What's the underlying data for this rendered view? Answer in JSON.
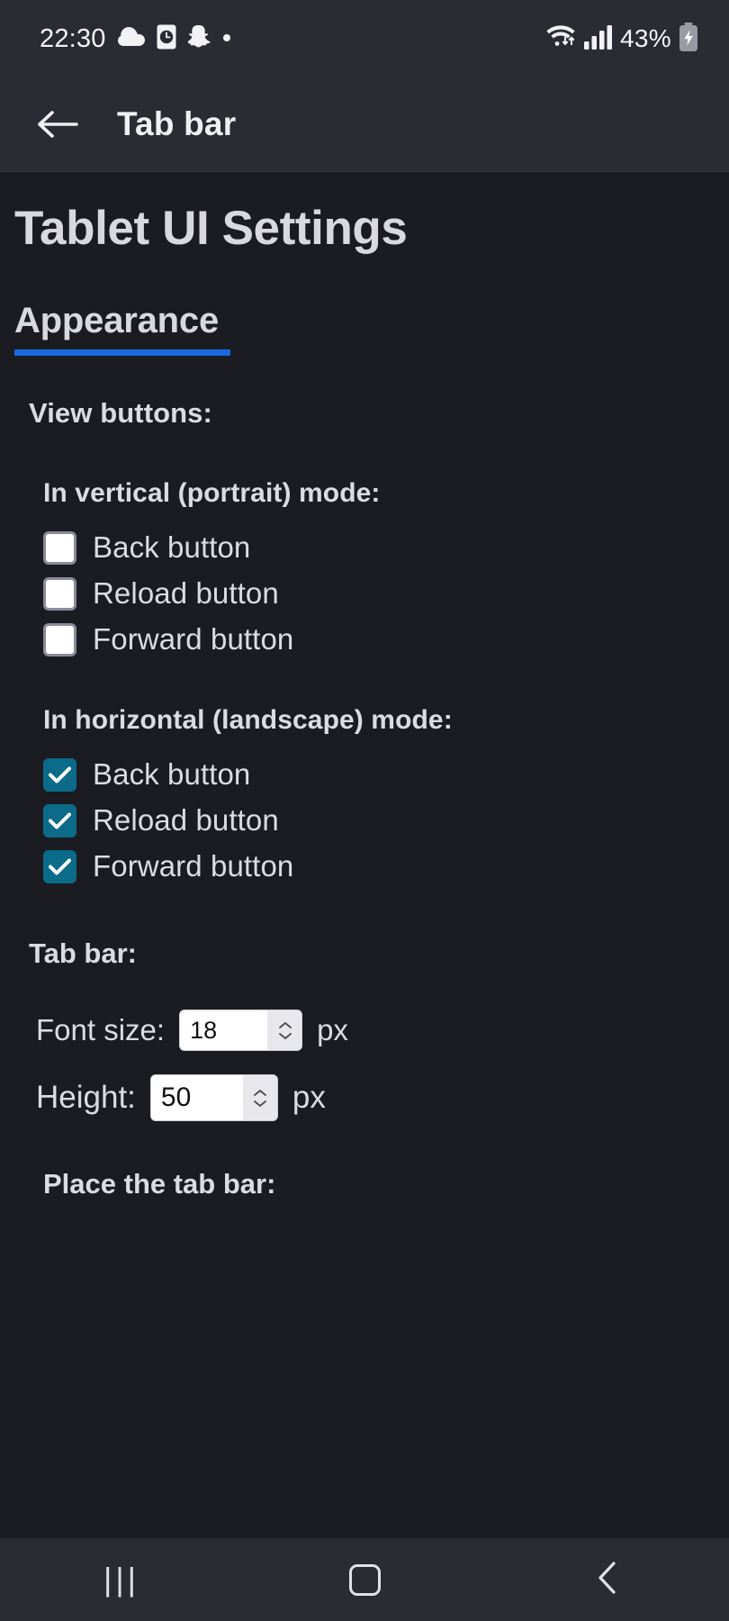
{
  "status_bar": {
    "time": "22:30",
    "left_icons": [
      "cloud-icon",
      "alarm-clock-icon",
      "snapchat-ghost-icon",
      "dot-icon"
    ],
    "right_icons": [
      "wifi-icon",
      "cellular-signal-icon"
    ],
    "battery_percent": "43%",
    "battery_icon": "battery-charging-icon"
  },
  "app_bar": {
    "back_icon": "back-arrow-icon",
    "title": "Tab bar"
  },
  "page": {
    "title": "Tablet UI Settings",
    "section": {
      "label": "Appearance",
      "underline_color": "#1a69e0"
    },
    "view_buttons": {
      "label": "View buttons:",
      "portrait": {
        "label": "In vertical (portrait) mode:",
        "options": [
          {
            "label": "Back button",
            "checked": false
          },
          {
            "label": "Reload button",
            "checked": false
          },
          {
            "label": "Forward button",
            "checked": false
          }
        ]
      },
      "landscape": {
        "label": "In horizontal (landscape) mode:",
        "options": [
          {
            "label": "Back button",
            "checked": true
          },
          {
            "label": "Reload button",
            "checked": true
          },
          {
            "label": "Forward button",
            "checked": true
          }
        ]
      }
    },
    "tab_bar": {
      "label": "Tab bar:",
      "font_size": {
        "label": "Font size:",
        "value": "18",
        "unit": "px",
        "spinner_icon": "spinner-up-down-icon"
      },
      "height": {
        "label": "Height:",
        "value": "50",
        "unit": "px",
        "spinner_icon": "spinner-up-down-icon"
      },
      "place_label": "Place the tab bar:"
    }
  },
  "nav_bar": {
    "recents": "|||",
    "recents_icon": "recents-icon",
    "home_icon": "home-square-icon",
    "back_icon": "nav-back-chevron-icon"
  },
  "colors": {
    "background": "#1b1c22",
    "bar_background": "#2a2b33",
    "text": "#dcdce0",
    "accent_blue": "#1a69e0",
    "checkbox_on": "#0d6b8a"
  }
}
